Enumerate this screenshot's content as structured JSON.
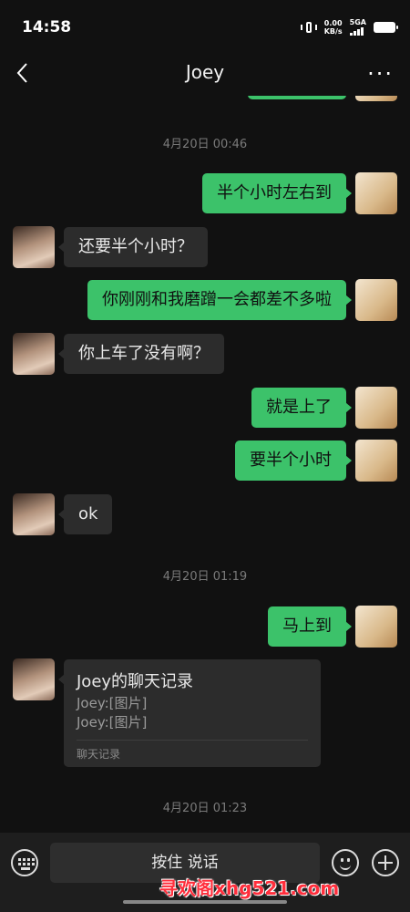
{
  "status": {
    "time": "14:58",
    "net_speed": "0.00",
    "net_unit": "KB/s",
    "signal_label": "5GA"
  },
  "header": {
    "back_icon": "chevron-left-icon",
    "title": "Joey",
    "more_icon": "more-icon"
  },
  "messages": [
    {
      "from": "me",
      "text": "半个小时左右到"
    },
    {
      "from": "joey",
      "text": "还要半个小时？"
    },
    {
      "from": "me",
      "text": "你刚刚和我磨蹭一会都差不多啦"
    },
    {
      "from": "joey",
      "text": "你上车了没有啊？"
    },
    {
      "from": "me",
      "text": "就是上了"
    },
    {
      "from": "me",
      "text": "要半个小时"
    },
    {
      "from": "joey",
      "text": "ok"
    },
    {
      "from": "me",
      "text": "马上到"
    }
  ],
  "timestamps": [
    "4月20日 00:46",
    "4月20日 01:19",
    "4月20日 01:23"
  ],
  "chat_record": {
    "title": "Joey的聊天记录",
    "lines": [
      "Joey:[图片]",
      "Joey:[图片]"
    ],
    "footer": "聊天记录"
  },
  "input_bar": {
    "voice_label": "按住 说话",
    "keyboard_icon": "keyboard-icon",
    "emoji_icon": "emoji-icon",
    "plus_icon": "plus-icon"
  },
  "watermark": "寻欢阁xhg521.com"
}
